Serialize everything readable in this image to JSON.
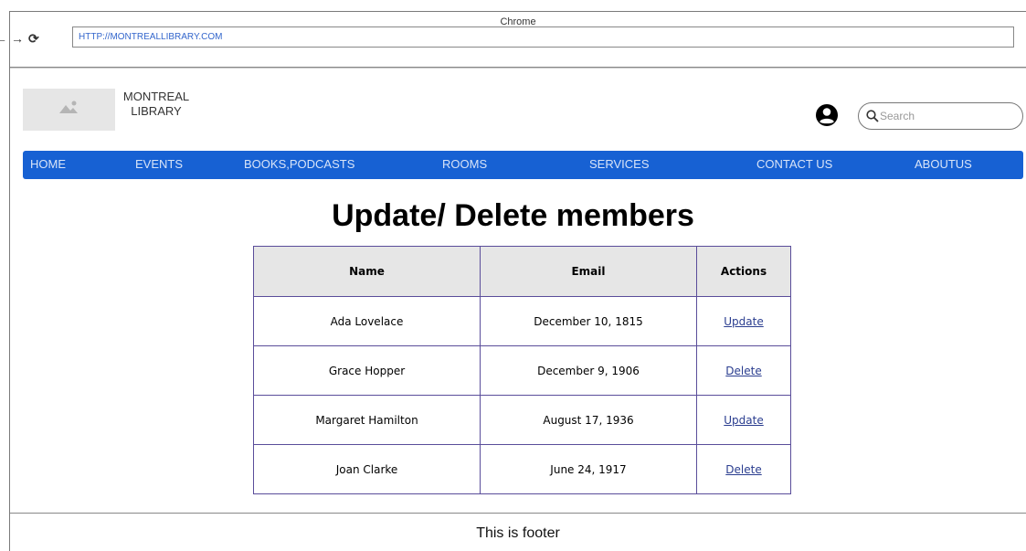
{
  "browser": {
    "title": "Chrome",
    "url": "HTTP://MONTREALLIBRARY.COM",
    "nav_back": "←",
    "nav_forward": "→",
    "nav_reload": "⟳"
  },
  "header": {
    "brand_line1": "MONTREAL",
    "brand_line2": "LIBRARY",
    "search_placeholder": "Search"
  },
  "nav": {
    "items": [
      {
        "label": "HOME"
      },
      {
        "label": "EVENTS"
      },
      {
        "label": "BOOKS,PODCASTS"
      },
      {
        "label": "ROOMS"
      },
      {
        "label": "SERVICES"
      },
      {
        "label": "CONTACT US"
      },
      {
        "label": "ABOUTUS"
      }
    ]
  },
  "page": {
    "title": "Update/ Delete members"
  },
  "table": {
    "headers": [
      "Name",
      "Email",
      "Actions"
    ],
    "rows": [
      {
        "name": "Ada Lovelace",
        "email": "December 10, 1815",
        "action": "Update "
      },
      {
        "name": "Grace Hopper",
        "email": "December 9, 1906",
        "action": "Delete"
      },
      {
        "name": "Margaret Hamilton",
        "email": "August 17, 1936",
        "action": "Update"
      },
      {
        "name": "Joan Clarke",
        "email": "June 24, 1917",
        "action": "Delete"
      }
    ]
  },
  "footer": {
    "text": "This is footer"
  },
  "colors": {
    "nav_bg": "#1761d3",
    "table_border": "#5a4d9a",
    "header_bg": "#e6e6e6",
    "link": "#2a3d8f"
  }
}
